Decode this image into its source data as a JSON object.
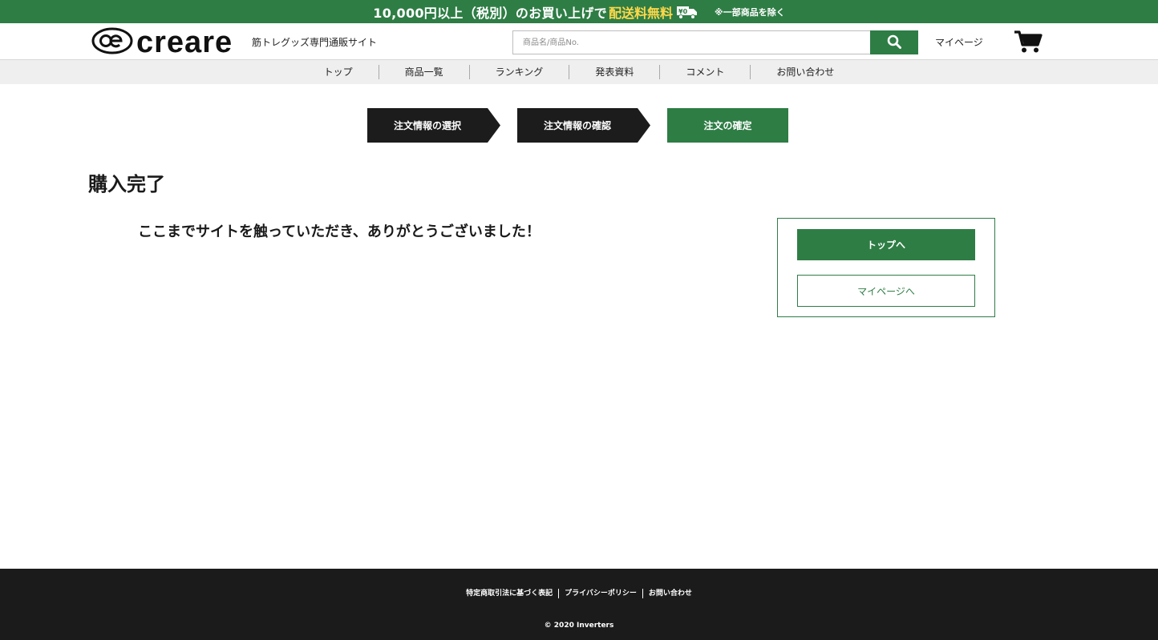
{
  "promo": {
    "lead": "10,000円以上（税別）のお買い上げで",
    "highlight": "配送料無料",
    "truck_badge": "¥0",
    "note": "※一部商品を除く",
    "icon": "delivery-truck-icon"
  },
  "header": {
    "logo_text": "creare",
    "tagline": "筋トレグッズ専門通販サイト",
    "search": {
      "placeholder": "商品名/商品No.",
      "value": "",
      "icon": "search-icon"
    },
    "mypage_label": "マイページ",
    "cart_icon": "cart-icon"
  },
  "nav": {
    "items": [
      {
        "label": "トップ"
      },
      {
        "label": "商品一覧"
      },
      {
        "label": "ランキング"
      },
      {
        "label": "発表資料"
      },
      {
        "label": "コメント"
      },
      {
        "label": "お問い合わせ"
      }
    ]
  },
  "steps": [
    {
      "label": "注文情報の選択",
      "state": "done"
    },
    {
      "label": "注文情報の確認",
      "state": "done"
    },
    {
      "label": "注文の確定",
      "state": "current"
    }
  ],
  "main": {
    "title": "購入完了",
    "message": "ここまでサイトを触っていただき、ありがとうございました！",
    "top_button": "トップへ",
    "mypage_button": "マイページへ"
  },
  "footer": {
    "links": [
      {
        "label": "特定商取引法に基づく表記"
      },
      {
        "label": "プライバシーポリシー"
      },
      {
        "label": "お問い合わせ"
      }
    ],
    "copyright": "© 2020 Inverters"
  },
  "colors": {
    "brand_green": "#2e7d45",
    "promo_highlight": "#ffd84a",
    "step_inactive": "#1c1c1c",
    "footer_bg": "#1b1b1b"
  }
}
